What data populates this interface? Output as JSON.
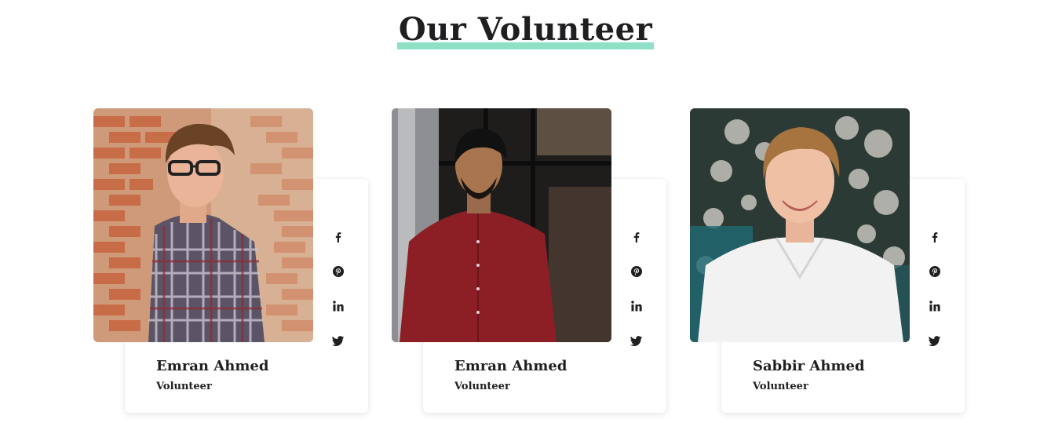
{
  "section": {
    "title": "Our Volunteer",
    "accent_color": "#8fe0c5"
  },
  "social_icons": [
    "facebook-icon",
    "pinterest-icon",
    "linkedin-icon",
    "twitter-icon"
  ],
  "volunteers": [
    {
      "name": "Emran Ahmed",
      "role": "Volunteer"
    },
    {
      "name": "Emran Ahmed",
      "role": "Volunteer"
    },
    {
      "name": "Sabbir Ahmed",
      "role": "Volunteer"
    }
  ]
}
